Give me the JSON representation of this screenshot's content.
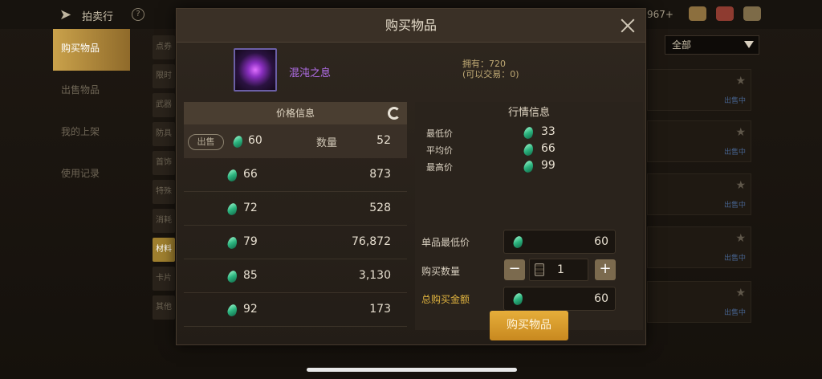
{
  "background": {
    "top_title": "拍卖行",
    "currency": "967+",
    "left_nav": [
      "购买物品",
      "出售物品",
      "我的上架",
      "使用记录"
    ],
    "categories": [
      "点券",
      "限时",
      "武器",
      "防具",
      "首饰",
      "特殊",
      "消耗",
      "材料",
      "卡片",
      "其他"
    ],
    "active_category_index": 7,
    "filter_label": "全部",
    "right_row_tags": [
      "出售中",
      "出售中",
      "出售中",
      "出售中",
      "出售中",
      "出售中"
    ]
  },
  "modal": {
    "title": "购买物品",
    "item": {
      "name": "混沌之息",
      "owned_line1": "拥有：720",
      "owned_line2": "(可以交易：0)"
    },
    "price_info": {
      "header": "价格信息",
      "sell_badge": "出售",
      "qty_label": "数量",
      "rows": [
        {
          "price": "60",
          "qty": "52"
        },
        {
          "price": "66",
          "qty": "873"
        },
        {
          "price": "72",
          "qty": "528"
        },
        {
          "price": "79",
          "qty": "76,872"
        },
        {
          "price": "85",
          "qty": "3,130"
        },
        {
          "price": "92",
          "qty": "173"
        }
      ]
    },
    "market_info": {
      "header": "行情信息",
      "lines": [
        {
          "label": "最低价",
          "value": "33"
        },
        {
          "label": "平均价",
          "value": "66"
        },
        {
          "label": "最高价",
          "value": "99"
        }
      ]
    },
    "purchase": {
      "unit_min_label": "单品最低价",
      "unit_min_value": "60",
      "quantity_label": "购买数量",
      "minus": "−",
      "plus": "+",
      "quantity_value": "1",
      "total_label": "总购买金额",
      "total_value": "60",
      "buy_button": "购买物品"
    },
    "colors": {
      "accent": "#e1b43f",
      "item_name": "#b570ef",
      "gem": "#2bb37e"
    }
  }
}
